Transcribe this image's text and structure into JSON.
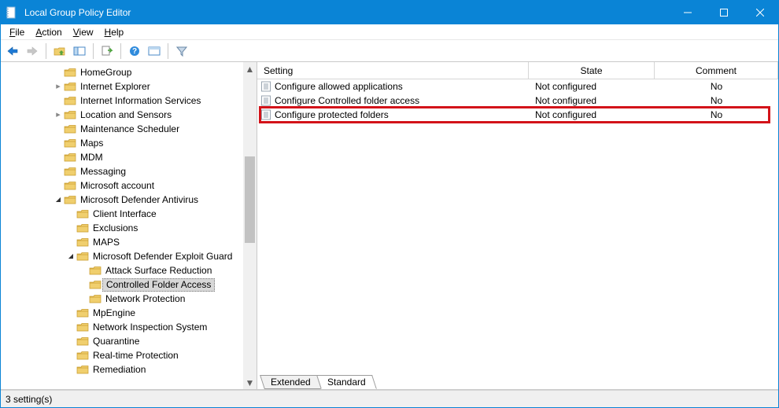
{
  "window": {
    "title": "Local Group Policy Editor"
  },
  "menus": {
    "file": "File",
    "action": "Action",
    "view": "View",
    "help": "Help"
  },
  "tree": {
    "items": [
      {
        "indent": 4,
        "exp": "",
        "label": "HomeGroup"
      },
      {
        "indent": 4,
        "exp": ">",
        "label": "Internet Explorer"
      },
      {
        "indent": 4,
        "exp": "",
        "label": "Internet Information Services"
      },
      {
        "indent": 4,
        "exp": ">",
        "label": "Location and Sensors"
      },
      {
        "indent": 4,
        "exp": "",
        "label": "Maintenance Scheduler"
      },
      {
        "indent": 4,
        "exp": "",
        "label": "Maps"
      },
      {
        "indent": 4,
        "exp": "",
        "label": "MDM"
      },
      {
        "indent": 4,
        "exp": "",
        "label": "Messaging"
      },
      {
        "indent": 4,
        "exp": "",
        "label": "Microsoft account"
      },
      {
        "indent": 4,
        "exp": "v",
        "label": "Microsoft Defender Antivirus"
      },
      {
        "indent": 5,
        "exp": "",
        "label": "Client Interface"
      },
      {
        "indent": 5,
        "exp": "",
        "label": "Exclusions"
      },
      {
        "indent": 5,
        "exp": "",
        "label": "MAPS"
      },
      {
        "indent": 5,
        "exp": "v",
        "label": "Microsoft Defender Exploit Guard"
      },
      {
        "indent": 6,
        "exp": "",
        "label": "Attack Surface Reduction"
      },
      {
        "indent": 6,
        "exp": "",
        "label": "Controlled Folder Access",
        "selected": true
      },
      {
        "indent": 6,
        "exp": "",
        "label": "Network Protection"
      },
      {
        "indent": 5,
        "exp": "",
        "label": "MpEngine"
      },
      {
        "indent": 5,
        "exp": "",
        "label": "Network Inspection System"
      },
      {
        "indent": 5,
        "exp": "",
        "label": "Quarantine"
      },
      {
        "indent": 5,
        "exp": "",
        "label": "Real-time Protection"
      },
      {
        "indent": 5,
        "exp": "",
        "label": "Remediation"
      }
    ]
  },
  "list": {
    "cols": {
      "setting": "Setting",
      "state": "State",
      "comment": "Comment"
    },
    "rows": [
      {
        "setting": "Configure allowed applications",
        "state": "Not configured",
        "comment": "No"
      },
      {
        "setting": "Configure Controlled folder access",
        "state": "Not configured",
        "comment": "No"
      },
      {
        "setting": "Configure protected folders",
        "state": "Not configured",
        "comment": "No",
        "highlighted": true
      }
    ]
  },
  "tabs": {
    "extended": "Extended",
    "standard": "Standard"
  },
  "status": {
    "text": "3 setting(s)"
  }
}
